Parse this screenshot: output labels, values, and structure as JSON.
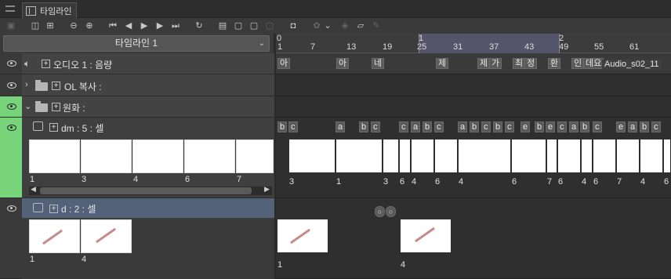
{
  "panel": {
    "title": "타임라인"
  },
  "toolbar": {
    "icons": [
      "timeline-icon",
      "frame-icon",
      "fit-frame-icon",
      "zoom-out-icon",
      "zoom-in-icon",
      "first-frame-icon",
      "prev-frame-icon",
      "play-icon",
      "next-frame-icon",
      "last-frame-icon",
      "loop-icon",
      "new-animation-folder-icon",
      "new-cell-icon",
      "specify-cell-icon",
      "delete-cell-icon",
      "camera-icon",
      "onion-skin-icon",
      "chevron-down-icon",
      "light-table-icon",
      "register-light-table-icon",
      "edit-icon"
    ]
  },
  "timeline_select": {
    "label": "타임라인 1"
  },
  "ruler": {
    "frames": [
      "0",
      "1",
      "7",
      "13",
      "19",
      "25",
      "31",
      "37",
      "43",
      "49",
      "55",
      "61"
    ],
    "seconds": [
      "1",
      "2"
    ]
  },
  "layers": [
    {
      "name": "오디오 1 : 음량"
    },
    {
      "name": "OL 복사 :"
    },
    {
      "name": "원화 :"
    },
    {
      "name": "dm : 5 : 셀",
      "thumbs": [
        "1",
        "3",
        "4",
        "6",
        "7"
      ]
    },
    {
      "name": "d : 2 : 셀",
      "thumbs": [
        "1",
        "4"
      ]
    }
  ],
  "audio_track": {
    "marks": [
      "아",
      "아",
      "네",
      "제",
      "제",
      "가",
      "최",
      "정",
      "환",
      "인",
      "데요"
    ],
    "file": "Audio_s02_11"
  },
  "dm_track": {
    "marks": [
      "b",
      "c",
      "a",
      "b",
      "c",
      "c",
      "a",
      "b",
      "c",
      "a",
      "b",
      "c",
      "b",
      "c",
      "e",
      "b",
      "e",
      "c",
      "a",
      "b",
      "c",
      "e",
      "a",
      "b",
      "c"
    ],
    "numbers": [
      "3",
      "1",
      "3",
      "6",
      "4",
      "6",
      "4",
      "6",
      "7",
      "6",
      "4",
      "6",
      "7",
      "4",
      "6"
    ]
  },
  "d_track": {
    "numbers": [
      "1",
      "4"
    ]
  }
}
